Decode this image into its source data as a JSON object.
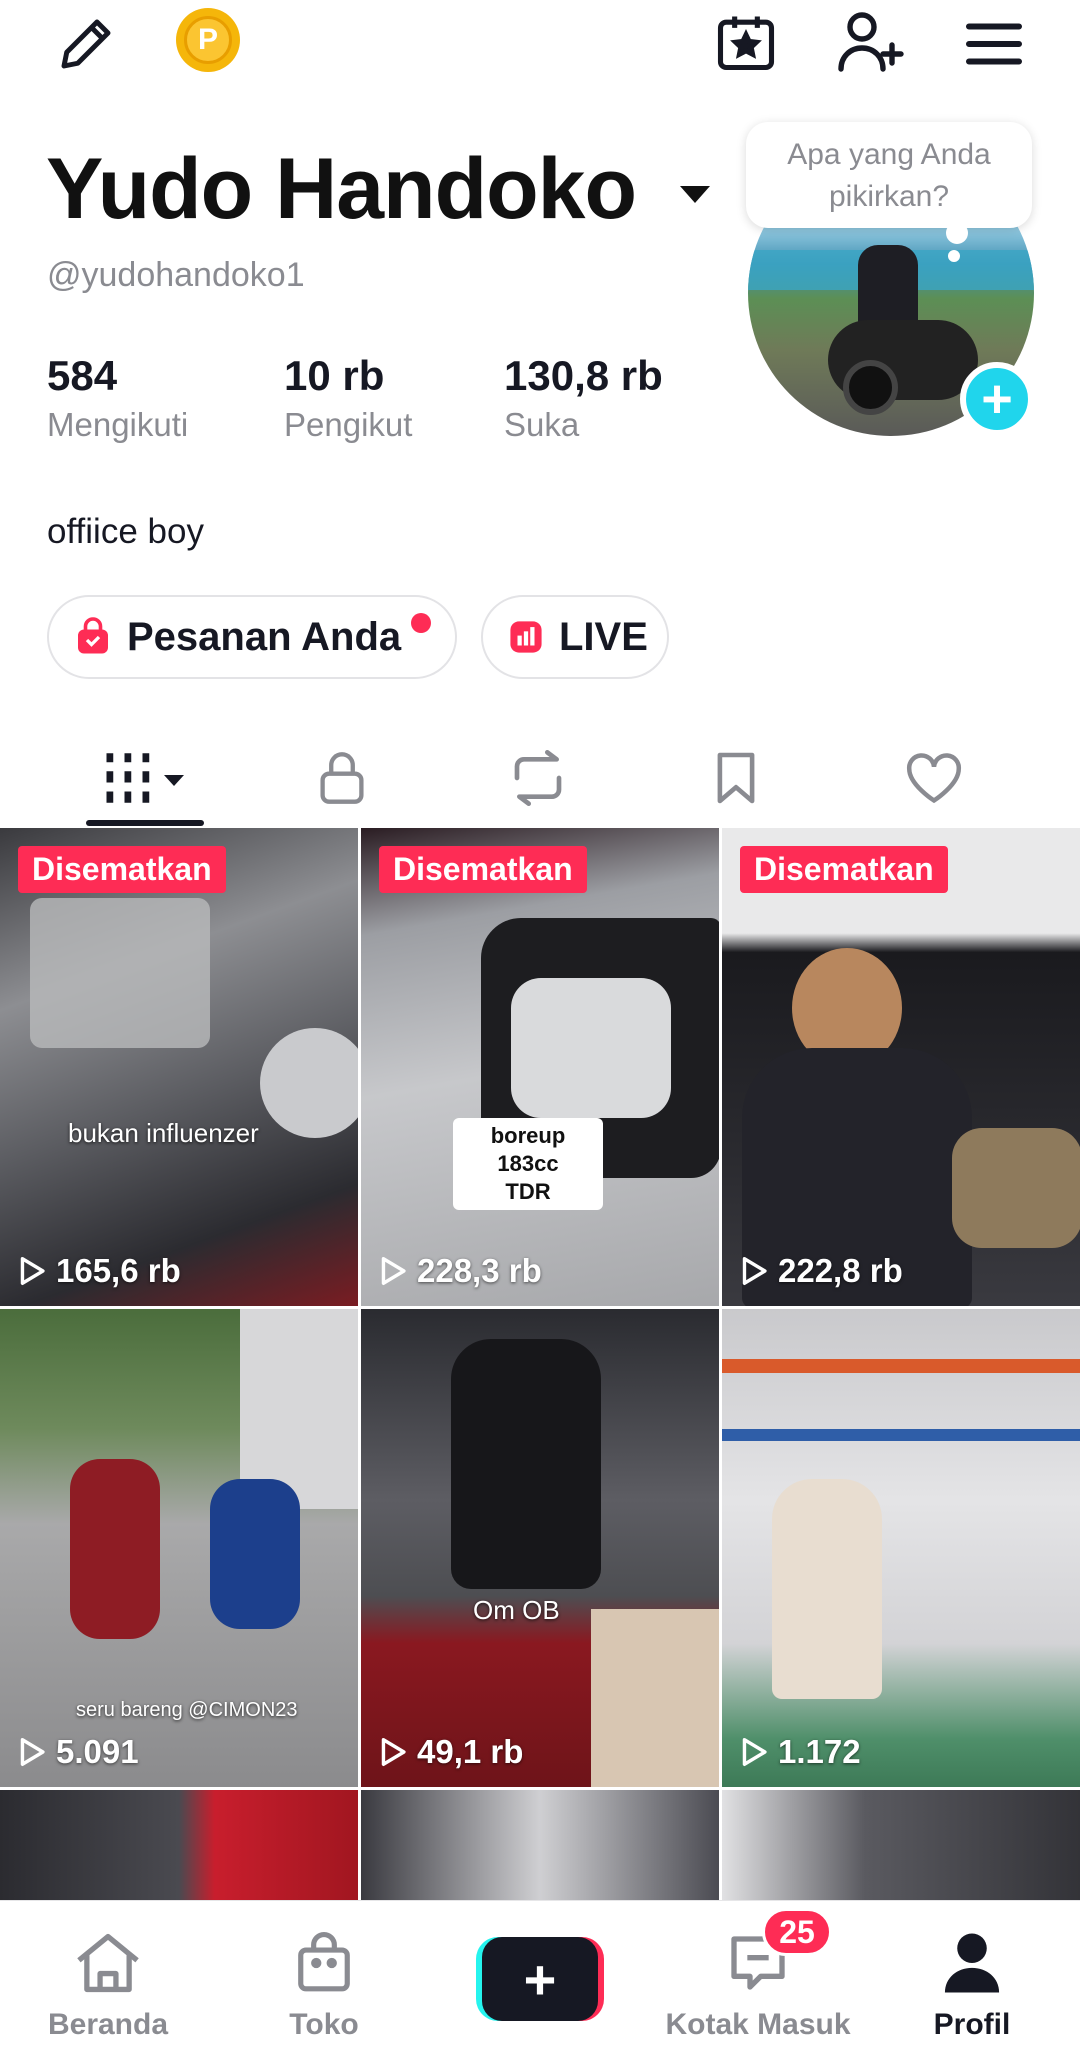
{
  "profile": {
    "name": "Yudo Handoko",
    "handle": "@yudohandoko1",
    "bio": "offiice boy",
    "avatar_prompt": "Apa yang Anda pikirkan?",
    "stats": [
      {
        "value": "584",
        "label": "Mengikuti"
      },
      {
        "value": "10 rb",
        "label": "Pengikut"
      },
      {
        "value": "130,8 rb",
        "label": "Suka"
      }
    ]
  },
  "coin_letter": "P",
  "pills": {
    "orders_label": "Pesanan Anda",
    "live_label": "LIVE"
  },
  "videos": [
    {
      "pinned": "Disematkan",
      "views": "165,6 rb",
      "caption": "bukan influenzer"
    },
    {
      "pinned": "Disematkan",
      "views": "228,3 rb",
      "caption": "boreup 183cc\nTDR"
    },
    {
      "pinned": "Disematkan",
      "views": "222,8 rb",
      "caption": ""
    },
    {
      "pinned": "",
      "views": "5.091",
      "caption": "seru bareng @CIMON23"
    },
    {
      "pinned": "",
      "views": "49,1 rb",
      "caption": "Om OB"
    },
    {
      "pinned": "",
      "views": "1.172",
      "caption": ""
    }
  ],
  "bottom_nav": {
    "home": "Beranda",
    "shop": "Toko",
    "inbox": "Kotak Masuk",
    "inbox_count": "25",
    "profile": "Profil"
  },
  "colors": {
    "accent_red": "#fe2c55",
    "accent_cyan": "#25f4ee",
    "text_primary": "#161823",
    "text_secondary": "#8a8b91"
  }
}
